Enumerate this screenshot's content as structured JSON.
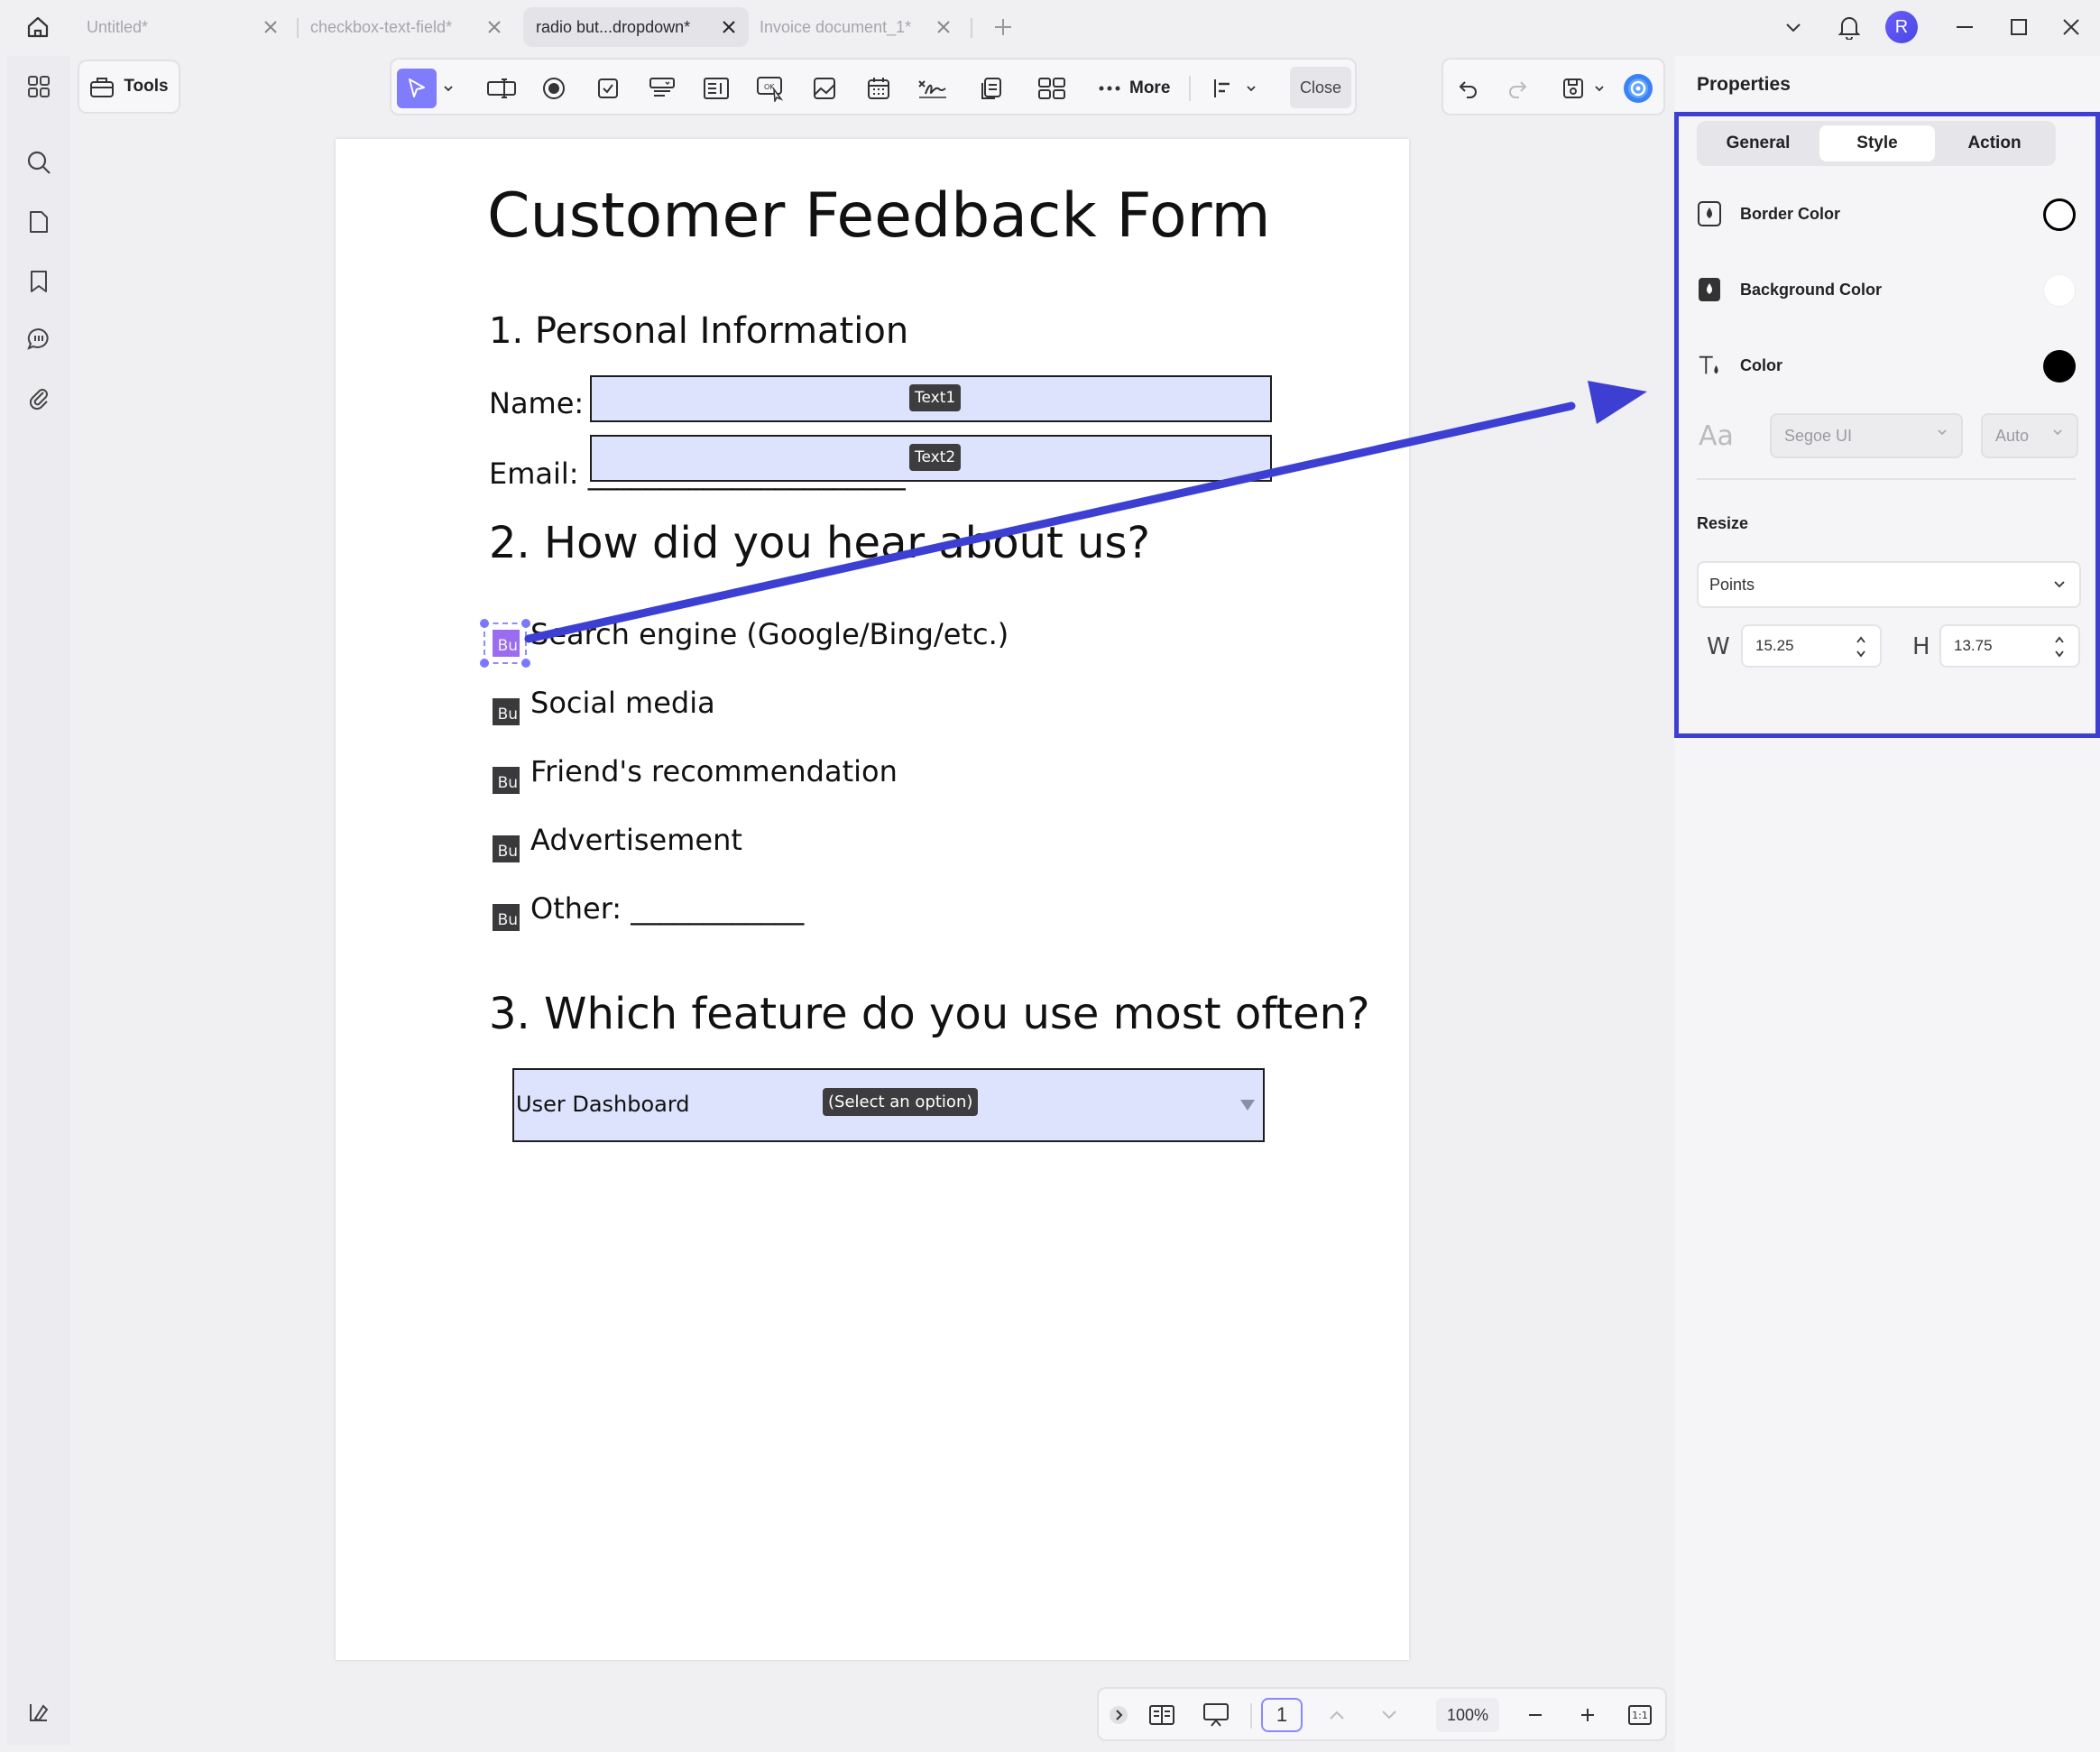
{
  "tabs": [
    {
      "label": "Untitled*",
      "active": false
    },
    {
      "label": "checkbox-text-field*",
      "active": false
    },
    {
      "label": "radio but...dropdown*",
      "active": true
    },
    {
      "label": "Invoice document_1*",
      "active": false
    }
  ],
  "window": {
    "avatar_letter": "R"
  },
  "toolbar": {
    "tools_label": "Tools",
    "more_label": "More",
    "close_label": "Close"
  },
  "document": {
    "title": "Customer Feedback Form",
    "section1": "1. Personal Information",
    "name_label": "Name: _",
    "email_label": "Email: ______________________",
    "text1_tag": "Text1",
    "text2_tag": "Text2",
    "section2": "2. How did you hear about us?",
    "radio_box_text": "Bu",
    "options": [
      "Search engine (Google/Bing/etc.)",
      "Social media",
      "Friend's recommendation",
      "Advertisement",
      "Other: ____________"
    ],
    "section3": "3. Which feature do you use most often?",
    "dropdown_value": "User Dashboard",
    "dropdown_tag": "(Select an option)"
  },
  "bottombar": {
    "page_number": "1",
    "zoom": "100%",
    "fit_label": "1:1"
  },
  "properties": {
    "title": "Properties",
    "tabs": [
      "General",
      "Style",
      "Action"
    ],
    "active_tab": "Style",
    "border_color_label": "Border Color",
    "background_color_label": "Background Color",
    "color_label": "Color",
    "font_family": "Segoe UI",
    "font_size": "Auto",
    "font_icon_text": "Aa",
    "resize_label": "Resize",
    "units": "Points",
    "w_label": "W",
    "w_value": "15.25",
    "h_label": "H",
    "h_value": "13.75",
    "colors": {
      "border": "#000000",
      "background": "#ffffff",
      "text": "#000000"
    }
  },
  "colors": {
    "accent": "#7f7dfb",
    "annotation_arrow": "#3d3fd2",
    "field_fill": "#dde2fd"
  }
}
